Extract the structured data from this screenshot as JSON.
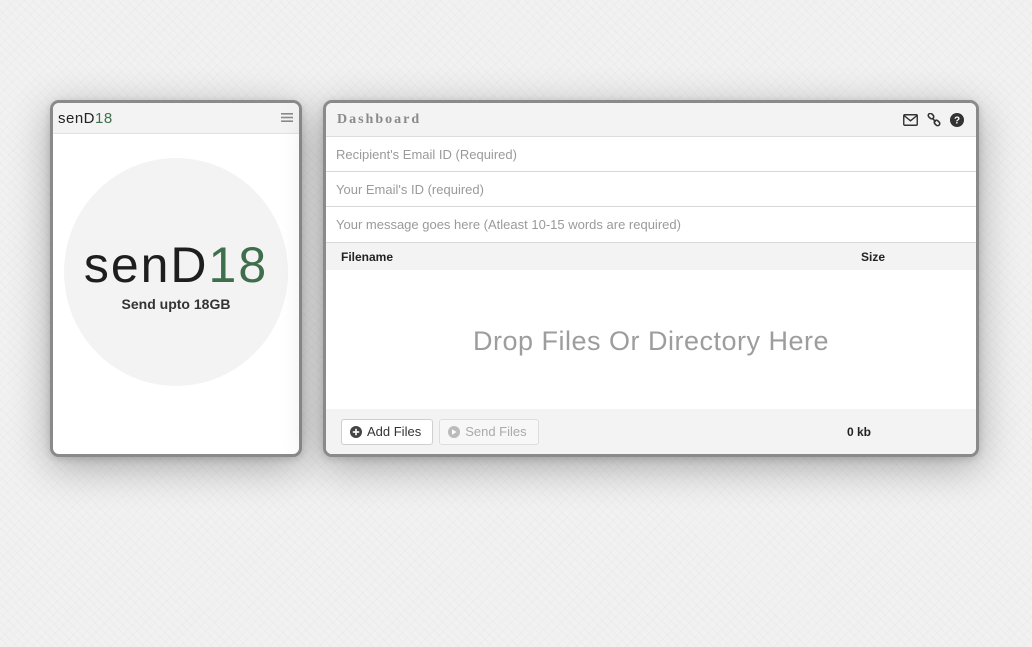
{
  "brand": {
    "logo_text": "senD",
    "logo_num": "18",
    "tagline": "Send upto 18GB",
    "accent_color": "#3f6e4d"
  },
  "left_panel": {
    "menu_icon": "hamburger-menu-icon"
  },
  "dashboard": {
    "title": "Dashboard",
    "icons": [
      "mail-icon",
      "link-icon",
      "help-icon"
    ],
    "fields": {
      "recipient_placeholder": "Recipient's Email ID (Required)",
      "sender_placeholder": "Your Email's ID (required)",
      "message_placeholder": "Your message goes here (Atleast 10-15 words are required)"
    },
    "table": {
      "col_filename": "Filename",
      "col_size": "Size"
    },
    "dropzone_text": "Drop Files Or Directory Here",
    "footer": {
      "add_label": "Add Files",
      "send_label": "Send Files",
      "total_size": "0 kb"
    }
  }
}
